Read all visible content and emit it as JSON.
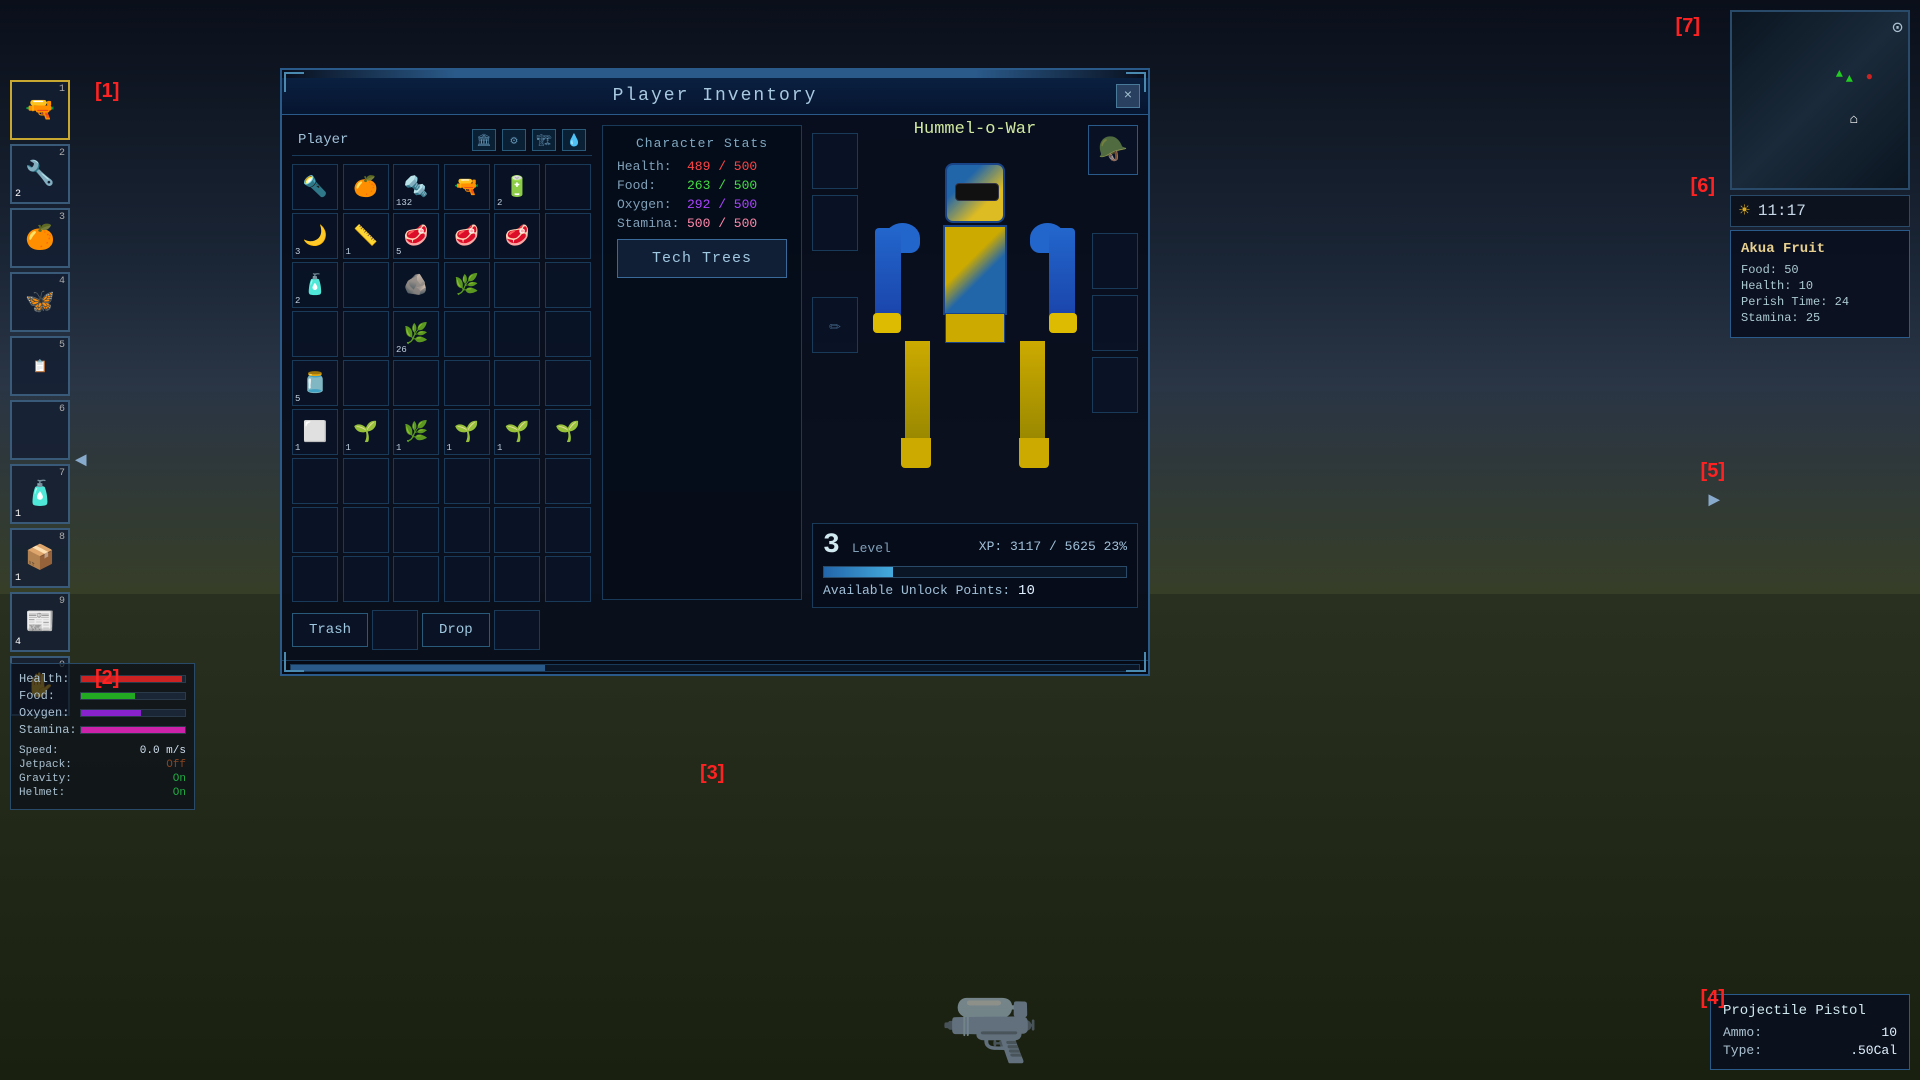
{
  "window": {
    "title": "Player Inventory",
    "close_label": "×"
  },
  "hud_labels": {
    "label1": "[1]",
    "label2": "[2]",
    "label3": "[3]",
    "label4": "[4]",
    "label5": "[5]",
    "label6": "[6]",
    "label7": "[7]"
  },
  "toolbar": {
    "slots": [
      {
        "num": "1",
        "icon": "🔫",
        "count": "",
        "active": true
      },
      {
        "num": "2",
        "icon": "🔧",
        "count": "2"
      },
      {
        "num": "3",
        "icon": "🍊",
        "count": ""
      },
      {
        "num": "4",
        "icon": "🦋",
        "count": ""
      },
      {
        "num": "5",
        "icon": "📋",
        "count": ""
      },
      {
        "num": "6",
        "icon": ""
      },
      {
        "num": "7",
        "icon": "🧴",
        "count": "1"
      },
      {
        "num": "8",
        "icon": "📦",
        "count": "1"
      },
      {
        "num": "9",
        "icon": "📰",
        "count": "4"
      },
      {
        "num": "0",
        "icon": "✋",
        "count": ""
      }
    ]
  },
  "stats": {
    "health_label": "Health:",
    "food_label": "Food:",
    "oxygen_label": "Oxygen:",
    "stamina_label": "Stamina:",
    "speed_label": "Speed:",
    "speed_val": "0.0 m/s",
    "jetpack_label": "Jetpack:",
    "jetpack_val": "Off",
    "gravity_label": "Gravity:",
    "gravity_val": "On",
    "helmet_label": "Helmet:",
    "helmet_val": "On"
  },
  "time": {
    "value": "11:17"
  },
  "tooltip": {
    "title": "Akua Fruit",
    "food_label": "Food:",
    "food_val": "50",
    "health_label": "Health:",
    "health_val": "10",
    "perish_label": "Perish Time:",
    "perish_val": "24",
    "stamina_label": "Stamina:",
    "stamina_val": "25"
  },
  "weapon": {
    "name": "Projectile Pistol",
    "ammo_label": "Ammo:",
    "ammo_val": "10",
    "type_label": "Type:",
    "type_val": ".50Cal"
  },
  "inventory": {
    "player_label": "Player",
    "icons": [
      "🏛",
      "⚙",
      "🏗",
      "💧"
    ],
    "grid": [
      {
        "icon": "🔦",
        "count": ""
      },
      {
        "icon": "🍊",
        "count": ""
      },
      {
        "icon": "🔩",
        "count": "132"
      },
      {
        "icon": "🔫",
        "count": ""
      },
      {
        "icon": "🔋",
        "count": "2"
      },
      {
        "icon": ""
      },
      {
        "icon": "🌙",
        "count": "3"
      },
      {
        "icon": "📏",
        "count": "1"
      },
      {
        "icon": "🥩",
        "count": "5"
      },
      {
        "icon": "🥩",
        "count": ""
      },
      {
        "icon": "🥩",
        "count": ""
      },
      {
        "icon": ""
      },
      {
        "icon": "🧴",
        "count": "2"
      },
      {
        "icon": ""
      },
      {
        "icon": "🪨",
        "count": ""
      },
      {
        "icon": "🌿",
        "count": ""
      },
      {
        "icon": ""
      },
      {
        "icon": ""
      },
      {
        "icon": ""
      },
      {
        "icon": ""
      },
      {
        "icon": "🌿",
        "count": "26"
      },
      {
        "icon": ""
      },
      {
        "icon": ""
      },
      {
        "icon": ""
      },
      {
        "icon": "🫙",
        "count": "5"
      },
      {
        "icon": ""
      },
      {
        "icon": ""
      },
      {
        "icon": ""
      },
      {
        "icon": ""
      },
      {
        "icon": ""
      },
      {
        "icon": "⬜",
        "count": "1"
      },
      {
        "icon": "🌱",
        "count": "1"
      },
      {
        "icon": "🌿",
        "count": "1"
      },
      {
        "icon": "🌱",
        "count": "1"
      },
      {
        "icon": "🌱",
        "count": "1"
      },
      {
        "icon": "🌱",
        "count": ""
      },
      {
        "icon": ""
      },
      {
        "icon": ""
      },
      {
        "icon": ""
      },
      {
        "icon": ""
      },
      {
        "icon": ""
      },
      {
        "icon": ""
      },
      {
        "icon": ""
      },
      {
        "icon": ""
      },
      {
        "icon": ""
      },
      {
        "icon": ""
      },
      {
        "icon": ""
      },
      {
        "icon": ""
      },
      {
        "icon": ""
      },
      {
        "icon": ""
      },
      {
        "icon": ""
      },
      {
        "icon": ""
      },
      {
        "icon": ""
      },
      {
        "icon": ""
      }
    ],
    "trash_label": "Trash",
    "drop_label": "Drop"
  },
  "character": {
    "name": "Hummel-o-War",
    "stats_title": "Character Stats",
    "health_label": "Health:",
    "health_val": "489 / 500",
    "food_label": "Food:",
    "food_val": "263 / 500",
    "oxygen_label": "Oxygen:",
    "oxygen_val": "292 / 500",
    "stamina_label": "Stamina:",
    "stamina_val": "500 / 500",
    "tech_trees_label": "Tech Trees",
    "level_label": "Level",
    "level_num": "3",
    "xp_label": "XP:",
    "xp_current": "3117",
    "xp_max": "5625",
    "xp_pct": "23%",
    "xp_text": "XP: 3117 / 5625  23%",
    "unlock_label": "Available Unlock Points:",
    "unlock_val": "10"
  }
}
